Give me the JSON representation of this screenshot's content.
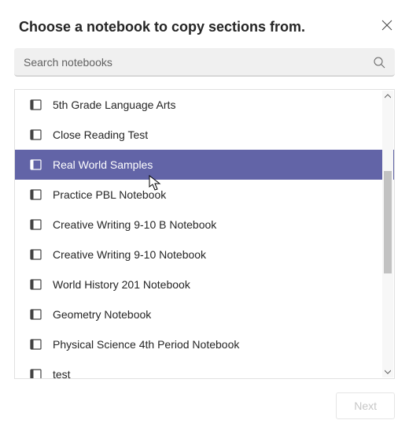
{
  "title": "Choose a notebook to copy sections from.",
  "search": {
    "placeholder": "Search notebooks",
    "value": ""
  },
  "notebooks": [
    {
      "label": "5th Grade Language Arts",
      "selected": false
    },
    {
      "label": "Close Reading Test",
      "selected": false
    },
    {
      "label": "Real World Samples",
      "selected": true
    },
    {
      "label": "Practice PBL Notebook",
      "selected": false
    },
    {
      "label": "Creative Writing 9-10 B Notebook",
      "selected": false
    },
    {
      "label": "Creative Writing 9-10 Notebook",
      "selected": false
    },
    {
      "label": "World History 201 Notebook",
      "selected": false
    },
    {
      "label": "Geometry Notebook",
      "selected": false
    },
    {
      "label": "Physical Science 4th Period Notebook",
      "selected": false
    },
    {
      "label": "test",
      "selected": false
    }
  ],
  "footer": {
    "next_label": "Next"
  },
  "colors": {
    "accent": "#6264a7"
  }
}
